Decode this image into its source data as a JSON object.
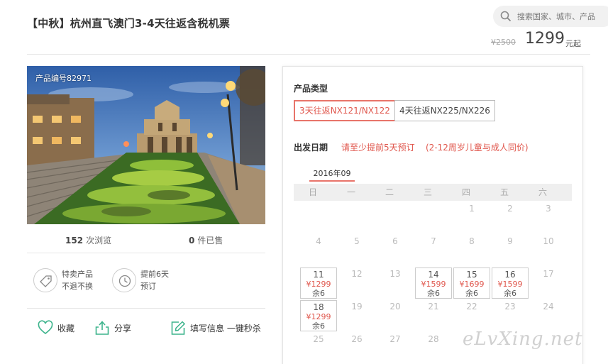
{
  "title": "【中秋】杭州直飞澳门3-4天往返含税机票",
  "search": {
    "placeholder": "搜索国家、城市、产品"
  },
  "price": {
    "original": "¥2500",
    "current": "1299",
    "unit": "元起"
  },
  "photo": {
    "code": "产品编号82971"
  },
  "stats": {
    "views_num": "152",
    "views_label": "次浏览",
    "sold_num": "0",
    "sold_label": "件已售"
  },
  "features": [
    {
      "icon": "tag-icon",
      "line1": "特卖产品",
      "line2": "不退不换"
    },
    {
      "icon": "clock-icon",
      "line1": "提前6天",
      "line2": "预订"
    }
  ],
  "actions": {
    "favorite": "收藏",
    "share": "分享",
    "fill_info": "填写信息 一键秒杀"
  },
  "product_type": {
    "label": "产品类型",
    "options": [
      "3天往返NX121/NX122",
      "4天往返NX225/NX226"
    ],
    "selected_index": 0
  },
  "departure": {
    "label": "出发日期",
    "note1": "请至少提前5天预订",
    "note2": "(2-12周岁儿童与成人同价)"
  },
  "calendar": {
    "month": "2016年09",
    "weekdays": [
      "日",
      "一",
      "二",
      "三",
      "四",
      "五",
      "六"
    ],
    "first_weekday": 4,
    "visible_days": 28,
    "prices": {
      "11": {
        "price": "¥1299",
        "remain": "余6"
      },
      "14": {
        "price": "¥1599",
        "remain": "余6"
      },
      "15": {
        "price": "¥1699",
        "remain": "余6"
      },
      "16": {
        "price": "¥1599",
        "remain": "余6"
      },
      "18": {
        "price": "¥1299",
        "remain": "余6"
      }
    }
  },
  "watermark": "eLvXing.net",
  "colors": {
    "accent": "#e0574d",
    "action_green": "#3bb38b"
  }
}
